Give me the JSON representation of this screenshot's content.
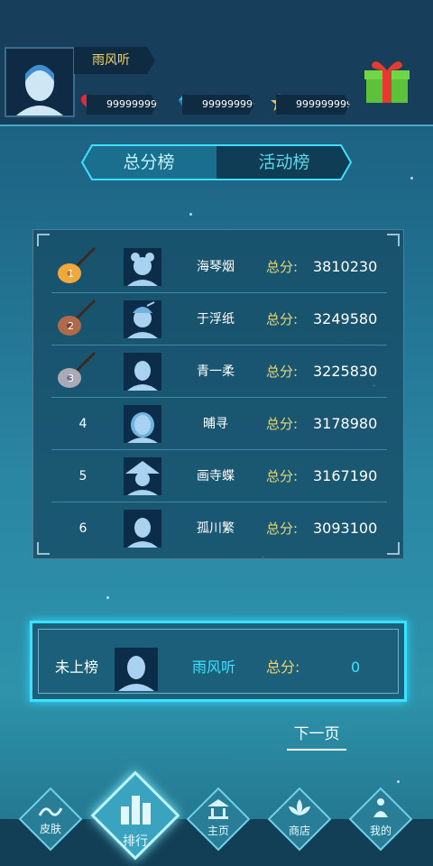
{
  "header": {
    "player_name": "雨风听",
    "hearts": "999999999",
    "diamonds": "999999999",
    "stars": "999999999",
    "gift_icon": "gift-icon"
  },
  "tabs": [
    {
      "label": "总分榜",
      "active": true
    },
    {
      "label": "活动榜",
      "active": false
    }
  ],
  "leaderboard": {
    "score_label": "总分:",
    "rows": [
      {
        "rank": "1",
        "name": "海琴烟",
        "score": "3810230",
        "medal": true
      },
      {
        "rank": "2",
        "name": "于浮纸",
        "score": "3249580",
        "medal": true
      },
      {
        "rank": "3",
        "name": "青一柔",
        "score": "3225830",
        "medal": true
      },
      {
        "rank": "4",
        "name": "晡寻",
        "score": "3178980",
        "medal": false
      },
      {
        "rank": "5",
        "name": "画寺蝶",
        "score": "3167190",
        "medal": false
      },
      {
        "rank": "6",
        "name": "孤川繁",
        "score": "3093100",
        "medal": false
      }
    ]
  },
  "my_rank": {
    "rank": "未上榜",
    "name": "雨风听",
    "score_label": "总分:",
    "score": "0"
  },
  "next_page": "下一页",
  "nav": [
    {
      "label": "皮肤",
      "icon": "wave-icon"
    },
    {
      "label": "排行",
      "icon": "bar-chart-icon"
    },
    {
      "label": "主页",
      "icon": "pavilion-icon"
    },
    {
      "label": "商店",
      "icon": "lotus-icon"
    },
    {
      "label": "我的",
      "icon": "meditation-icon"
    }
  ],
  "colors": {
    "accent": "#39e6ff",
    "gold": "#f3d36b",
    "medal_gold": "#f0a93a",
    "medal_bronze": "#b06a4a",
    "medal_silver": "#a9a9b8"
  }
}
